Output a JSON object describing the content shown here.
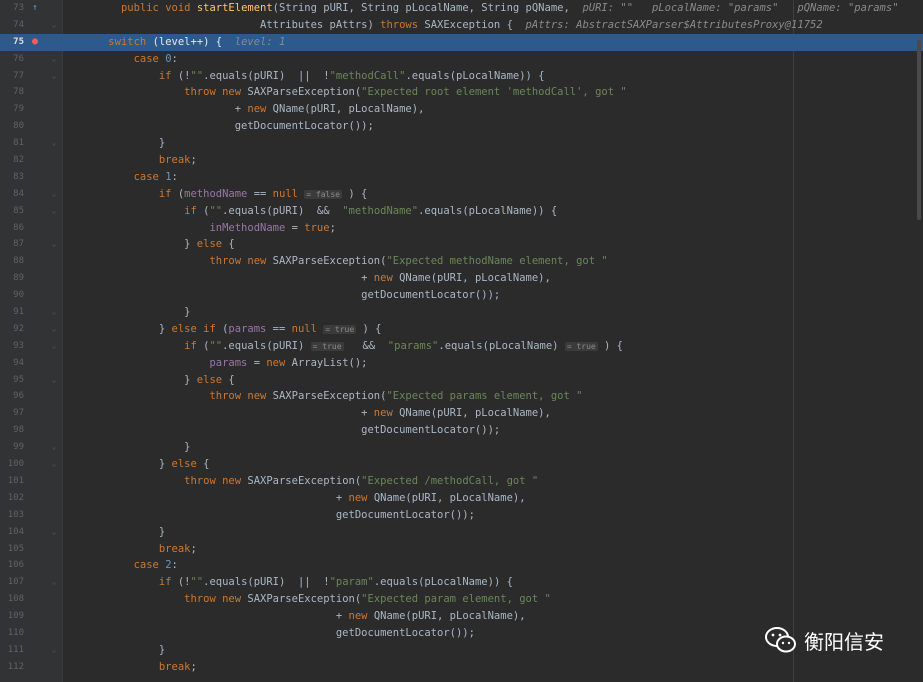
{
  "lines": [
    {
      "n": "73",
      "gicon": "override-icon",
      "fold": "",
      "tokens": [
        [
          "      "
        ],
        [
          "public ",
          "kw"
        ],
        [
          "void ",
          "kw"
        ],
        [
          "startElement",
          "fn"
        ],
        [
          "(String pURI, String pLocalName, String pQName,  "
        ],
        [
          "pURI: \"\"   pLocalName: \"params\"   pQName: \"params\"",
          "hint"
        ]
      ]
    },
    {
      "n": "74",
      "gicon": "",
      "fold": "fold",
      "tokens": [
        [
          "                            Attributes pAttrs) "
        ],
        [
          "throws ",
          "kw"
        ],
        [
          "SAXException {  "
        ],
        [
          "pAttrs: AbstractSAXParser$AttributesProxy@11752",
          "hint"
        ]
      ]
    },
    {
      "n": "75",
      "gicon": "breakpoint-icon",
      "fold": "fold",
      "current": true,
      "tokens": [
        [
          "    "
        ],
        [
          "switch ",
          "kw"
        ],
        [
          "(level++) {  "
        ],
        [
          "level: 1",
          "hint"
        ]
      ]
    },
    {
      "n": "76",
      "fold": "fold",
      "tokens": [
        [
          "        "
        ],
        [
          "case ",
          "kw"
        ],
        [
          "0",
          "num"
        ],
        [
          ":"
        ]
      ]
    },
    {
      "n": "77",
      "fold": "fold",
      "tokens": [
        [
          "            "
        ],
        [
          "if ",
          "kw"
        ],
        [
          "(!"
        ],
        [
          "\"\"",
          "str"
        ],
        [
          ".equals(pURI)  ||  !"
        ],
        [
          "\"methodCall\"",
          "str"
        ],
        [
          ".equals(pLocalName)) {"
        ]
      ]
    },
    {
      "n": "78",
      "tokens": [
        [
          "                "
        ],
        [
          "throw new ",
          "kw"
        ],
        [
          "SAXParseException("
        ],
        [
          "\"Expected root element 'methodCall', got \"",
          "str"
        ]
      ]
    },
    {
      "n": "79",
      "tokens": [
        [
          "                        + "
        ],
        [
          "new ",
          "kw"
        ],
        [
          "QName(pURI, pLocalName),"
        ]
      ]
    },
    {
      "n": "80",
      "tokens": [
        [
          "                        getDocumentLocator());"
        ]
      ]
    },
    {
      "n": "81",
      "fold": "fold",
      "tokens": [
        [
          "            }"
        ]
      ]
    },
    {
      "n": "82",
      "tokens": [
        [
          "            "
        ],
        [
          "break",
          "kw"
        ],
        [
          ";"
        ]
      ]
    },
    {
      "n": "83",
      "tokens": [
        [
          "        "
        ],
        [
          "case ",
          "kw"
        ],
        [
          "1",
          "num"
        ],
        [
          ":"
        ]
      ]
    },
    {
      "n": "84",
      "fold": "fold",
      "tokens": [
        [
          "            "
        ],
        [
          "if ",
          "kw"
        ],
        [
          "("
        ],
        [
          "methodName",
          "fld"
        ],
        [
          " == "
        ],
        [
          "null ",
          "kw"
        ],
        [
          "= false",
          "ib"
        ],
        [
          " ) {"
        ]
      ]
    },
    {
      "n": "85",
      "fold": "fold",
      "tokens": [
        [
          "                "
        ],
        [
          "if ",
          "kw"
        ],
        [
          "("
        ],
        [
          "\"\"",
          "str"
        ],
        [
          ".equals(pURI)  &&  "
        ],
        [
          "\"methodName\"",
          "str"
        ],
        [
          ".equals(pLocalName)) {"
        ]
      ]
    },
    {
      "n": "86",
      "tokens": [
        [
          "                    "
        ],
        [
          "inMethodName",
          "fld"
        ],
        [
          " = "
        ],
        [
          "true",
          "kw"
        ],
        [
          ";"
        ]
      ]
    },
    {
      "n": "87",
      "fold": "fold",
      "tokens": [
        [
          "                } "
        ],
        [
          "else ",
          "kw"
        ],
        [
          "{"
        ]
      ]
    },
    {
      "n": "88",
      "tokens": [
        [
          "                    "
        ],
        [
          "throw new ",
          "kw"
        ],
        [
          "SAXParseException("
        ],
        [
          "\"Expected methodName element, got \"",
          "str"
        ]
      ]
    },
    {
      "n": "89",
      "tokens": [
        [
          "                                            + "
        ],
        [
          "new ",
          "kw"
        ],
        [
          "QName(pURI, pLocalName),"
        ]
      ]
    },
    {
      "n": "90",
      "tokens": [
        [
          "                                            getDocumentLocator());"
        ]
      ]
    },
    {
      "n": "91",
      "fold": "fold",
      "tokens": [
        [
          "                }"
        ]
      ]
    },
    {
      "n": "92",
      "fold": "fold",
      "tokens": [
        [
          "            } "
        ],
        [
          "else if ",
          "kw"
        ],
        [
          "("
        ],
        [
          "params",
          "fld"
        ],
        [
          " == "
        ],
        [
          "null ",
          "kw"
        ],
        [
          "= true",
          "ib"
        ],
        [
          " ) {"
        ]
      ]
    },
    {
      "n": "93",
      "fold": "fold",
      "tokens": [
        [
          "                "
        ],
        [
          "if ",
          "kw"
        ],
        [
          "("
        ],
        [
          "\"\"",
          "str"
        ],
        [
          ".equals(pURI) "
        ],
        [
          "= true",
          "ib"
        ],
        [
          "   &&  "
        ],
        [
          "\"params\"",
          "str"
        ],
        [
          ".equals(pLocalName) "
        ],
        [
          "= true",
          "ib"
        ],
        [
          " ) {"
        ]
      ]
    },
    {
      "n": "94",
      "tokens": [
        [
          "                    "
        ],
        [
          "params",
          "fld"
        ],
        [
          " = "
        ],
        [
          "new ",
          "kw"
        ],
        [
          "ArrayList();"
        ]
      ]
    },
    {
      "n": "95",
      "fold": "fold",
      "tokens": [
        [
          "                } "
        ],
        [
          "else ",
          "kw"
        ],
        [
          "{"
        ]
      ]
    },
    {
      "n": "96",
      "tokens": [
        [
          "                    "
        ],
        [
          "throw new ",
          "kw"
        ],
        [
          "SAXParseException("
        ],
        [
          "\"Expected params element, got \"",
          "str"
        ]
      ]
    },
    {
      "n": "97",
      "tokens": [
        [
          "                                            + "
        ],
        [
          "new ",
          "kw"
        ],
        [
          "QName(pURI, pLocalName),"
        ]
      ]
    },
    {
      "n": "98",
      "tokens": [
        [
          "                                            getDocumentLocator());"
        ]
      ]
    },
    {
      "n": "99",
      "fold": "fold",
      "tokens": [
        [
          "                }"
        ]
      ]
    },
    {
      "n": "100",
      "fold": "fold",
      "tokens": [
        [
          "            } "
        ],
        [
          "else ",
          "kw"
        ],
        [
          "{"
        ]
      ]
    },
    {
      "n": "101",
      "tokens": [
        [
          "                "
        ],
        [
          "throw new ",
          "kw"
        ],
        [
          "SAXParseException("
        ],
        [
          "\"Expected /methodCall, got \"",
          "str"
        ]
      ]
    },
    {
      "n": "102",
      "tokens": [
        [
          "                                        + "
        ],
        [
          "new ",
          "kw"
        ],
        [
          "QName(pURI, pLocalName),"
        ]
      ]
    },
    {
      "n": "103",
      "tokens": [
        [
          "                                        getDocumentLocator());"
        ]
      ]
    },
    {
      "n": "104",
      "fold": "fold",
      "tokens": [
        [
          "            }"
        ]
      ]
    },
    {
      "n": "105",
      "tokens": [
        [
          "            "
        ],
        [
          "break",
          "kw"
        ],
        [
          ";"
        ]
      ]
    },
    {
      "n": "106",
      "tokens": [
        [
          "        "
        ],
        [
          "case ",
          "kw"
        ],
        [
          "2",
          "num"
        ],
        [
          ":"
        ]
      ]
    },
    {
      "n": "107",
      "fold": "fold",
      "tokens": [
        [
          "            "
        ],
        [
          "if ",
          "kw"
        ],
        [
          "(!"
        ],
        [
          "\"\"",
          "str"
        ],
        [
          ".equals(pURI)  ||  !"
        ],
        [
          "\"param\"",
          "str"
        ],
        [
          ".equals(pLocalName)) {"
        ]
      ]
    },
    {
      "n": "108",
      "tokens": [
        [
          "                "
        ],
        [
          "throw new ",
          "kw"
        ],
        [
          "SAXParseException("
        ],
        [
          "\"Expected param element, got \"",
          "str"
        ]
      ]
    },
    {
      "n": "109",
      "tokens": [
        [
          "                                        + "
        ],
        [
          "new ",
          "kw"
        ],
        [
          "QName(pURI, pLocalName),"
        ]
      ]
    },
    {
      "n": "110",
      "tokens": [
        [
          "                                        getDocumentLocator());"
        ]
      ]
    },
    {
      "n": "111",
      "fold": "fold",
      "tokens": [
        [
          "            }"
        ]
      ]
    },
    {
      "n": "112",
      "tokens": [
        [
          "            "
        ],
        [
          "break",
          "kw"
        ],
        [
          ";"
        ]
      ]
    }
  ],
  "watermark": {
    "text": "衡阳信安",
    "icon": "wechat-icon"
  },
  "colors": {
    "keyword": "#cc7832",
    "string": "#6a8759",
    "field": "#9876aa",
    "number": "#6897bb",
    "current_line": "#2d5a8c",
    "background": "#2b2b2b"
  }
}
